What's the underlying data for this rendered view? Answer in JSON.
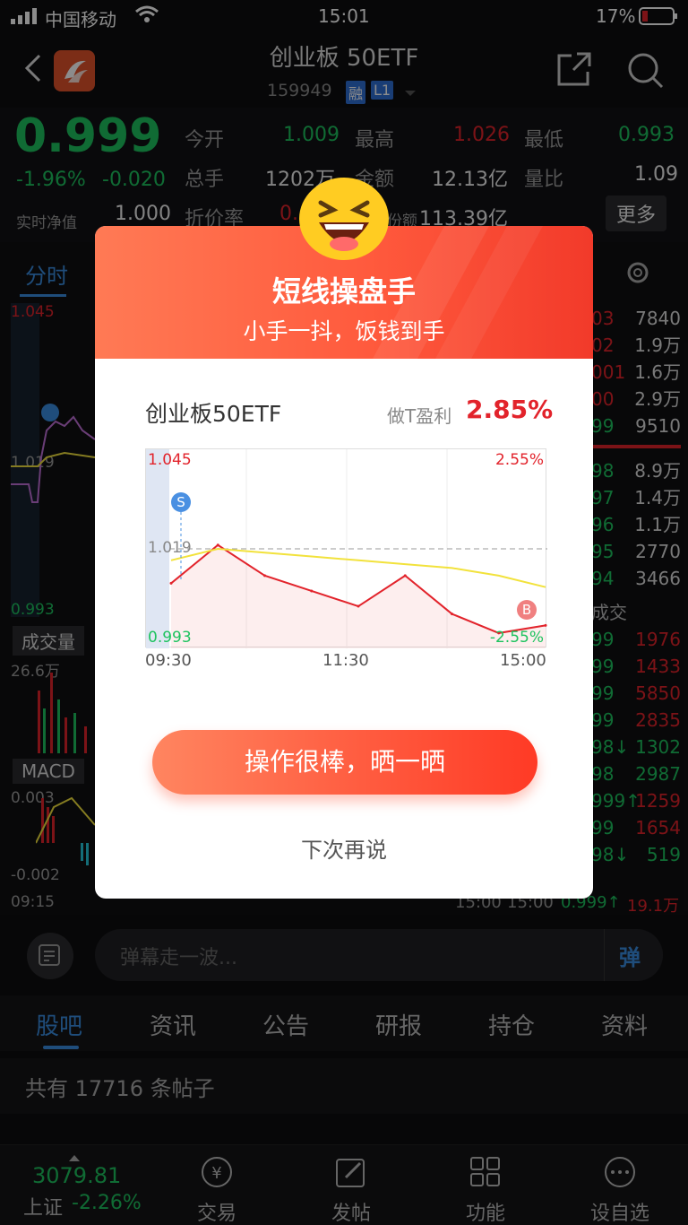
{
  "status_bar": {
    "carrier": "中国移动",
    "time": "15:01",
    "battery": "17%"
  },
  "header": {
    "title": "创业板 50ETF",
    "code": "159949",
    "badge_rong": "融",
    "badge_level": "L1"
  },
  "quote": {
    "price": "0.999",
    "change_pct": "-1.96%",
    "change": "-0.020",
    "nav_label": "实时净值",
    "nav_value": "1.000",
    "open_label": "今开",
    "open_value": "1.009",
    "high_label": "最高",
    "high_value": "1.026",
    "low_label": "最低",
    "low_value": "0.993",
    "volume_label": "总手",
    "volume_value": "1202万",
    "amount_label": "金额",
    "amount_value": "12.13亿",
    "ratio_label": "量比",
    "ratio_value": "1.09",
    "discount_label": "折价率",
    "discount_value": "0.",
    "share_label": "份额",
    "share_value": "113.39亿",
    "more_label": "更多"
  },
  "background_chart": {
    "tab_label": "分时",
    "price_high": "1.045",
    "price_mid": "1.019",
    "price_low": "0.993",
    "volume_label": "成交量",
    "volume_max": "26.6万",
    "macd_label": "MACD",
    "macd_high": "0.003",
    "macd_low": "-0.002",
    "time_start": "09:15",
    "order_book_vols": [
      "7840",
      "1.9万",
      "1.6万",
      "2.9万",
      "9510",
      "8.9万",
      "1.4万",
      "1.1万",
      "2770",
      "3466"
    ],
    "order_book_prices": [
      "03",
      "02",
      "001",
      "00",
      "99",
      "98",
      "97",
      "96",
      "95",
      "94"
    ],
    "trades_label": "成交",
    "trade_prices": [
      "99",
      "99",
      "99",
      "99",
      "98↓",
      "98",
      "999↑",
      "99",
      "98↓"
    ],
    "trade_vols": [
      "1976",
      "1433",
      "5850",
      "2835",
      "1302",
      "2987",
      "1259",
      "1654",
      "519"
    ],
    "last_trade_time": "15:00",
    "last_trade_time2": "15:00",
    "last_trade_price": "0.999↑",
    "last_trade_vol": "19.1万"
  },
  "barrage": {
    "placeholder": "弹幕走一波...",
    "button": "弹"
  },
  "tabs": [
    "股吧",
    "资讯",
    "公告",
    "研报",
    "持仓",
    "资料"
  ],
  "post_count": "共有 17716 条帖子",
  "bottom_nav": {
    "index_value": "3079.81",
    "index_name": "上证",
    "index_change": "-2.26%",
    "items": [
      "交易",
      "发帖",
      "功能",
      "设自选"
    ]
  },
  "modal": {
    "title": "短线操盘手",
    "subtitle": "小手一抖，饭钱到手",
    "fund_name": "创业板50ETF",
    "profit_label": "做T盈利",
    "profit_value": "2.85%",
    "chart_ytop": "1.045",
    "chart_ymid": "1.019",
    "chart_ybottom": "0.993",
    "chart_pct_top": "2.55%",
    "chart_pct_bottom": "-2.55%",
    "x_start": "09:30",
    "x_mid": "11:30",
    "x_end": "15:00",
    "sell_marker": "S",
    "buy_marker": "B",
    "share_button": "操作很棒，晒一晒",
    "later_button": "下次再说"
  },
  "chart_data": {
    "type": "line",
    "x": [
      "09:30",
      "10:00",
      "10:30",
      "11:00",
      "11:30",
      "13:30",
      "14:00",
      "14:30",
      "15:00"
    ],
    "series": [
      {
        "values": [
          1.01,
          1.02,
          1.012,
          1.008,
          1.004,
          1.012,
          1.002,
          0.997,
          0.999
        ]
      },
      {
        "values": [
          1.016,
          1.019,
          1.018,
          1.017,
          1.016,
          1.015,
          1.014,
          1.012,
          1.009
        ]
      }
    ],
    "ylim": [
      0.993,
      1.045
    ],
    "baseline": 1.019
  },
  "colors": {
    "up": "#e2232b",
    "down": "#1ec35f",
    "accent": "#ff5a3d",
    "avg_line": "#f2e23c"
  }
}
